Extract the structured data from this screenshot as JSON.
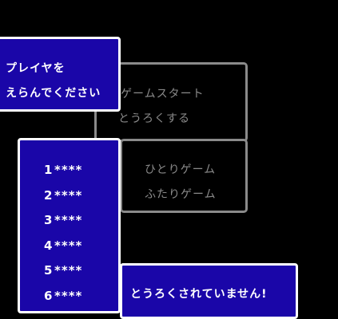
{
  "prompt_window": {
    "line1": "プレイヤを",
    "line2": "えらんでください"
  },
  "main_menu": {
    "items": [
      {
        "label": "ゲームスタート"
      },
      {
        "label": "とうろくする"
      }
    ]
  },
  "mode_menu": {
    "items": [
      {
        "label": "ひとりゲーム"
      },
      {
        "label": "ふたりゲーム"
      }
    ]
  },
  "player_slots": [
    {
      "number": "1",
      "name": "****"
    },
    {
      "number": "2",
      "name": "****"
    },
    {
      "number": "3",
      "name": "****"
    },
    {
      "number": "4",
      "name": "****"
    },
    {
      "number": "5",
      "name": "****"
    },
    {
      "number": "6",
      "name": "****"
    }
  ],
  "status_message": {
    "text": "とうろくされていません!"
  },
  "colors": {
    "window_blue": "#1a06a8",
    "inactive_gray": "#8a8a8a",
    "text_white": "#ffffff",
    "background": "#000000"
  }
}
